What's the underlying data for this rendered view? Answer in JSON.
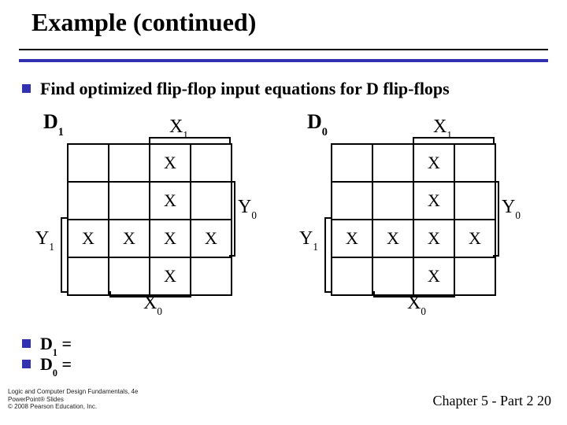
{
  "title": "Example  (continued)",
  "bullets": {
    "main": "Find optimized flip-flop input equations for D flip-flops",
    "eq1_lhs": "D",
    "eq1_sub": "1",
    "eq1_eq": " = ",
    "eq2_lhs": "D",
    "eq2_sub": "0",
    "eq2_eq": " = "
  },
  "kmaps": [
    {
      "D_label": "D",
      "D_sub": "1",
      "X1_label": "X",
      "X1_sub": "1",
      "X0_label": "X",
      "X0_sub": "0",
      "Y1_label": "Y",
      "Y1_sub": "1",
      "Y0_label": "Y",
      "Y0_sub": "0",
      "cells": [
        [
          "",
          "",
          "X",
          ""
        ],
        [
          "",
          "",
          "X",
          ""
        ],
        [
          "X",
          "X",
          "X",
          "X"
        ],
        [
          "",
          "",
          "X",
          ""
        ]
      ]
    },
    {
      "D_label": "D",
      "D_sub": "0",
      "X1_label": "X",
      "X1_sub": "1",
      "X0_label": "X",
      "X0_sub": "0",
      "Y1_label": "Y",
      "Y1_sub": "1",
      "Y0_label": "Y",
      "Y0_sub": "0",
      "cells": [
        [
          "",
          "",
          "X",
          ""
        ],
        [
          "",
          "",
          "X",
          ""
        ],
        [
          "X",
          "X",
          "X",
          "X"
        ],
        [
          "",
          "",
          "X",
          ""
        ]
      ]
    }
  ],
  "footer_left_lines": [
    "Logic and Computer Design Fundamentals, 4e",
    "PowerPoint® Slides",
    "© 2008 Pearson Education, Inc."
  ],
  "footer_right": "Chapter 5 - Part 2    20"
}
